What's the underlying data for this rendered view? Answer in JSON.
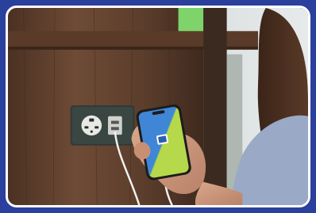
{
  "image": {
    "description_icon": "phone-charging-photo",
    "colors": {
      "frame": "#2b3f9c",
      "border": "#ffffff",
      "wood": "#6b4a35",
      "wood_dark": "#4e3425",
      "socket_plate": "#2f3a36",
      "phone_blue": "#3f86d6",
      "phone_green": "#b5d94a",
      "shelf_green": "#7fd36b"
    }
  }
}
